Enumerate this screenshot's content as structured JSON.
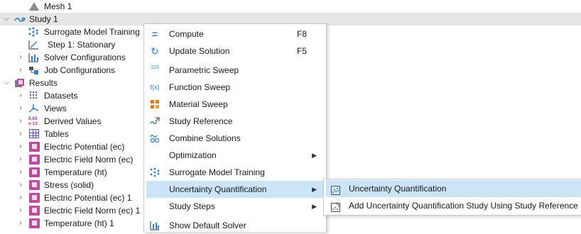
{
  "tree": {
    "mesh": {
      "label": "Mesh 1",
      "icon": "mesh-icon"
    },
    "study": {
      "label": "Study 1",
      "icon": "study-icon"
    },
    "surrogate": {
      "label": "Surrogate Model Training",
      "icon": "surrogate-icon"
    },
    "step1": {
      "label": "Step 1: Stationary",
      "icon": "stationary-step-icon"
    },
    "solver_configs": {
      "label": "Solver Configurations",
      "icon": "solver-icon"
    },
    "job_configs": {
      "label": "Job Configurations",
      "icon": "job-icon"
    },
    "results": {
      "label": "Results",
      "icon": "results-icon"
    },
    "datasets": {
      "label": "Datasets",
      "icon": "datasets-icon"
    },
    "views": {
      "label": "Views",
      "icon": "views-icon"
    },
    "derived_values": {
      "label": "Derived Values",
      "icon": "derived-values-icon",
      "icon_text": "8.85\ne-12"
    },
    "tables": {
      "label": "Tables",
      "icon": "table-icon"
    },
    "plots": [
      {
        "label": "Electric Potential (ec)"
      },
      {
        "label": "Electric Field Norm (ec)"
      },
      {
        "label": "Temperature (ht)"
      },
      {
        "label": "Stress (solid)"
      },
      {
        "label": "Electric Potential (ec) 1"
      },
      {
        "label": "Electric Field Norm (ec) 1"
      },
      {
        "label": "Temperature (ht) 1"
      }
    ]
  },
  "menu": {
    "compute": {
      "label": "Compute",
      "shortcut": "F8",
      "icon": "compute-icon",
      "glyph": "="
    },
    "update": {
      "label": "Update Solution",
      "shortcut": "F5",
      "icon": "update-icon",
      "glyph": "↻"
    },
    "param_sweep": {
      "label": "Parametric Sweep",
      "icon": "parametric-sweep-icon",
      "glyph": "123"
    },
    "func_sweep": {
      "label": "Function Sweep",
      "icon": "function-sweep-icon",
      "glyph": "f(x)"
    },
    "mat_sweep": {
      "label": "Material Sweep",
      "icon": "material-sweep-icon"
    },
    "study_ref": {
      "label": "Study Reference",
      "icon": "study-reference-icon"
    },
    "combine": {
      "label": "Combine Solutions",
      "icon": "combine-solutions-icon"
    },
    "optimization": {
      "label": "Optimization"
    },
    "surrogate": {
      "label": "Surrogate Model Training",
      "icon": "surrogate-icon"
    },
    "uq": {
      "label": "Uncertainty Quantification"
    },
    "study_steps": {
      "label": "Study Steps"
    },
    "show_solver": {
      "label": "Show Default Solver",
      "icon": "solver-icon"
    }
  },
  "submenu": {
    "uq": {
      "label": "Uncertainty Quantification",
      "icon": "uq-icon"
    },
    "add_uq": {
      "label": "Add Uncertainty Quantification Study Using Study Reference",
      "icon": "add-uq-icon"
    }
  },
  "colors": {
    "selection": "#e5e5e5",
    "hover": "#cce4f7",
    "plot_folder": "#c04aa0",
    "accent": "#2f7fd1"
  }
}
